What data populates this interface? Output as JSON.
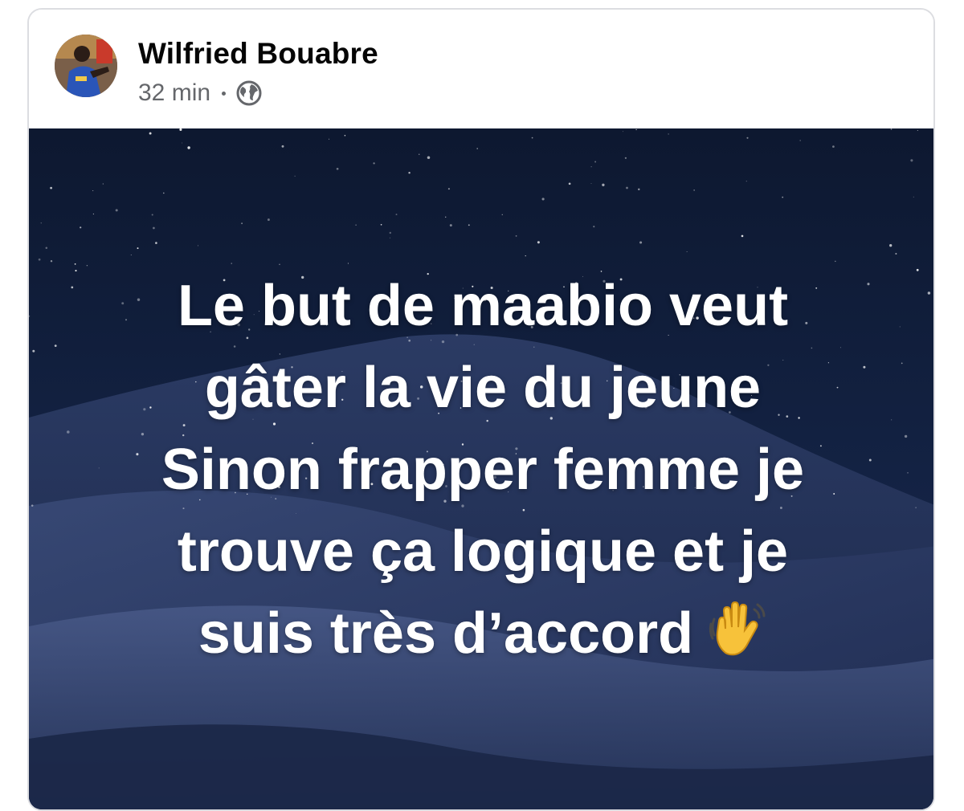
{
  "post": {
    "author_name": "Wilfried Bouabre",
    "timestamp": "32 min",
    "audience_icon": "globe-icon",
    "text_lines": [
      "Le but de maabio veut",
      "gâter la vie du jeune",
      "Sinon frapper femme je",
      "trouve ça logique et je",
      "suis très d’accord"
    ],
    "trailing_emoji": "waving-hand-icon"
  },
  "colors": {
    "author": "#050505",
    "meta": "#65676b",
    "background_top": "#0e1a33",
    "background_bottom": "#2a3a63",
    "text": "#ffffff"
  }
}
